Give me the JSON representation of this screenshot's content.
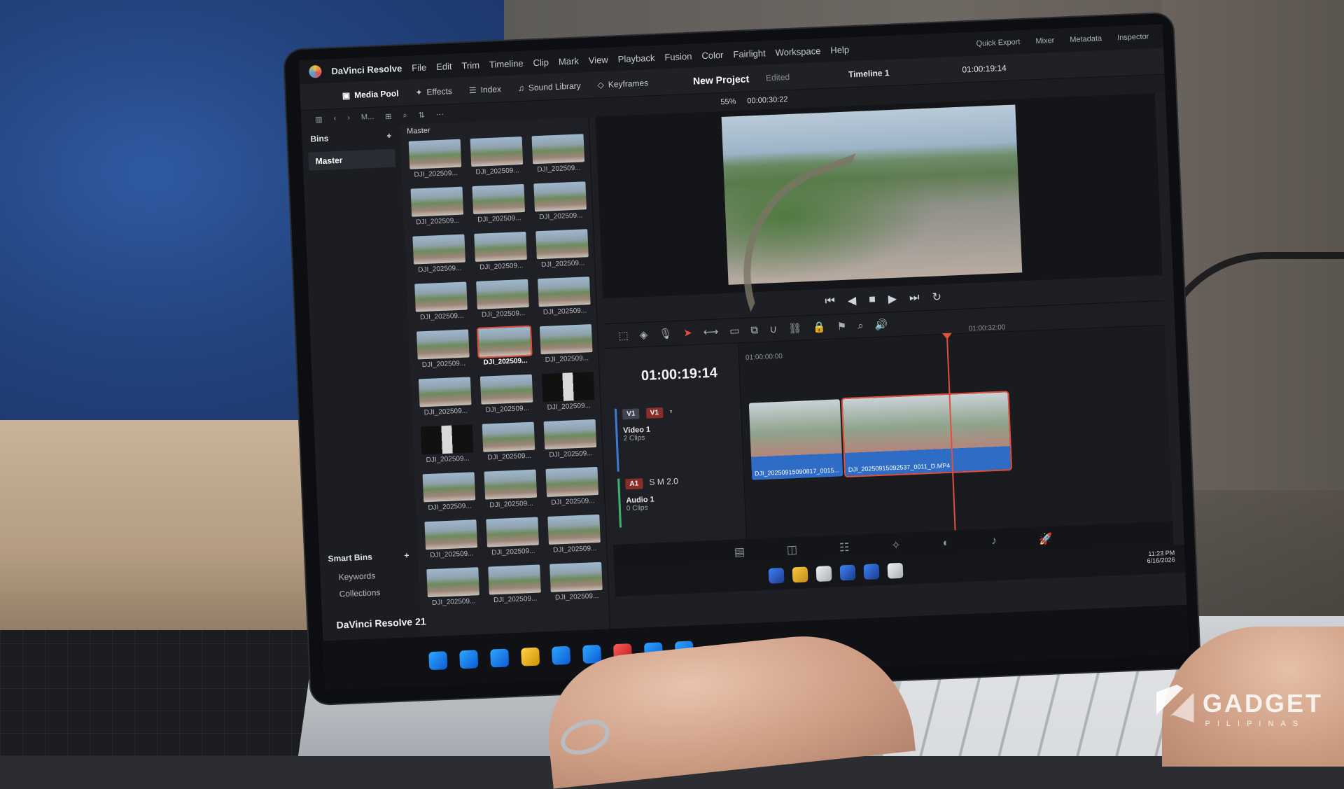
{
  "menubar": {
    "app_name": "DaVinci Resolve",
    "items": [
      "File",
      "Edit",
      "Trim",
      "Timeline",
      "Clip",
      "Mark",
      "View",
      "Playback",
      "Fusion",
      "Color",
      "Fairlight",
      "Workspace",
      "Help"
    ],
    "right": [
      "Quick Export",
      "Mixer",
      "Metadata",
      "Inspector"
    ]
  },
  "toolbar": {
    "media_pool": "Media Pool",
    "effects": "Effects",
    "index": "Index",
    "sound_library": "Sound Library",
    "keyframes": "Keyframes",
    "project": "New Project",
    "edited": "Edited",
    "timeline_name": "Timeline 1",
    "timecode": "01:00:19:14"
  },
  "subbar": {
    "pool_label": "M...",
    "zoom": "55%",
    "duration": "00:00:30:22"
  },
  "bins": {
    "title": "Bins",
    "master": "Master",
    "smart_title": "Smart Bins",
    "smart_items": [
      "Keywords",
      "Collections"
    ]
  },
  "pool": {
    "title": "Master",
    "clip_label": "DJI_202509..."
  },
  "timeline": {
    "timecode": "01:00:19:14",
    "ruler_start": "01:00:00:00",
    "ruler_end": "01:00:32:00",
    "video_track": {
      "chip1": "V1",
      "chip2": "V1",
      "name": "Video 1",
      "clips": "2 Clips"
    },
    "audio_track": {
      "chip": "A1",
      "name": "Audio 1",
      "clips": "0 Clips",
      "level": "2.0"
    },
    "clip1_label": "DJI_20250915090817_0015...",
    "clip2_label": "DJI_20250915092537_0011_D.MP4"
  },
  "system": {
    "time": "11:23 PM",
    "date": "6/16/2026",
    "resolve_tag": "DaVinci Resolve 21"
  },
  "watermark": {
    "name": "GADGET",
    "sub": "PILIPINAS"
  },
  "colors": {
    "accent_red": "#e2503c",
    "track_blue": "#3a7bd5",
    "audio_green": "#3cb371"
  }
}
